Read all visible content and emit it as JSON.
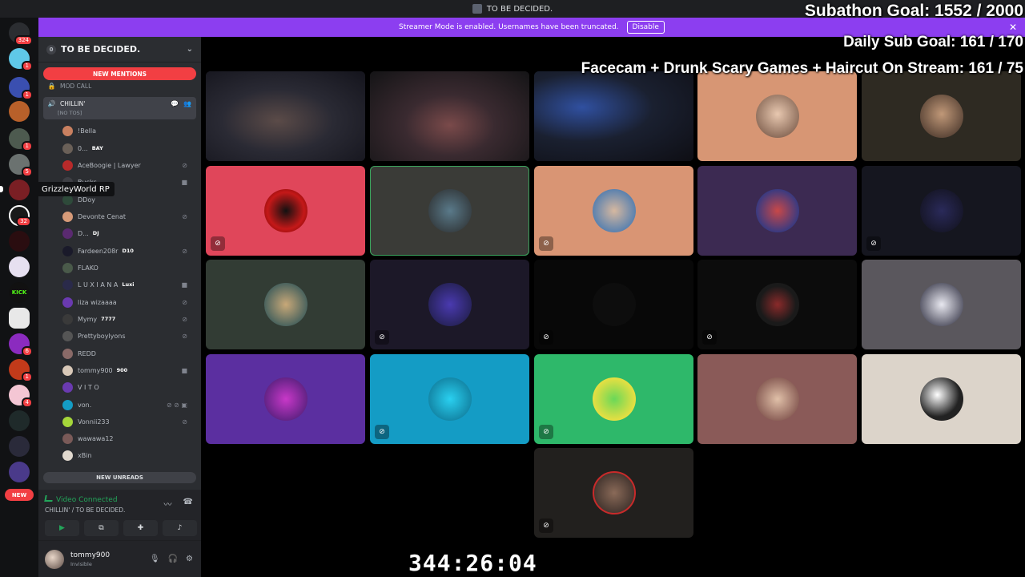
{
  "titlebar": {
    "title": "TO BE DECIDED."
  },
  "streamer_banner": {
    "text": "Streamer Mode is enabled. Usernames have been truncated.",
    "button": "Disable",
    "close": "✕"
  },
  "stream_overlay": {
    "line1": "Subathon Goal: 1552 / 2000",
    "line2": "Daily Sub Goal:  161 / 170",
    "line3": "Facecam + Drunk Scary Games + Haircut On Stream:  161 / 75"
  },
  "guilds": {
    "badges": [
      "324",
      "1",
      "1",
      "1",
      "5",
      "32",
      "6",
      "1",
      "4"
    ],
    "new_label": "NEW",
    "tooltip": "GrizzleyWorld RP",
    "kick_label": "KICK"
  },
  "sidebar": {
    "server_badge": "0",
    "server_name": "TO BE DECIDED.",
    "new_mentions": "NEW MENTIONS",
    "channels": [
      {
        "name": "MOD CALL"
      }
    ],
    "active_channel": {
      "name": "CHILLIN'",
      "subtitle": "[NO TOS]"
    },
    "members": [
      {
        "name": "!Bella",
        "tag": ""
      },
      {
        "name": "0...",
        "tag": "BAY"
      },
      {
        "name": "AceBoogie | Lawyer",
        "tag": ""
      },
      {
        "name": "Bucks",
        "tag": ""
      },
      {
        "name": "DDoy",
        "tag": ""
      },
      {
        "name": "Devonte Cenat",
        "tag": ""
      },
      {
        "name": "D...",
        "tag": "DJ"
      },
      {
        "name": "Fardeen208r",
        "tag": "D10"
      },
      {
        "name": "FLAKO",
        "tag": ""
      },
      {
        "name": "L U X I A N A",
        "tag": "Luxi"
      },
      {
        "name": "liza wizaaaa",
        "tag": ""
      },
      {
        "name": "Mymy",
        "tag": "7777"
      },
      {
        "name": "Prettyboylyons",
        "tag": ""
      },
      {
        "name": "REDD",
        "tag": ""
      },
      {
        "name": "tommy900",
        "tag": "900"
      },
      {
        "name": "V I T O",
        "tag": ""
      },
      {
        "name": "von.",
        "tag": ""
      },
      {
        "name": "Vonnii233",
        "tag": ""
      },
      {
        "name": "wawawa12",
        "tag": ""
      },
      {
        "name": "xBin",
        "tag": ""
      }
    ],
    "new_unreads": "NEW UNREADS"
  },
  "voice": {
    "status": "Video Connected",
    "location": "CHILLIN' / TO BE DECIDED."
  },
  "user": {
    "name": "tommy900",
    "status": "Invisible"
  },
  "timer": "344:26:04",
  "colors": {
    "accent": "#8c3ef0",
    "danger": "#f23f43",
    "online": "#23a55a",
    "tile_colors": [
      "#e0465a",
      "#3a3b37",
      "#d99574",
      "#3c2a52",
      "#15161f",
      "#323c34",
      "#1c1828",
      "#080808",
      "#0c0c0c",
      "#5a575d",
      "#5b2fa0",
      "#149cc5",
      "#2eb86a",
      "#8a5a58",
      "#dcd4ca"
    ]
  }
}
